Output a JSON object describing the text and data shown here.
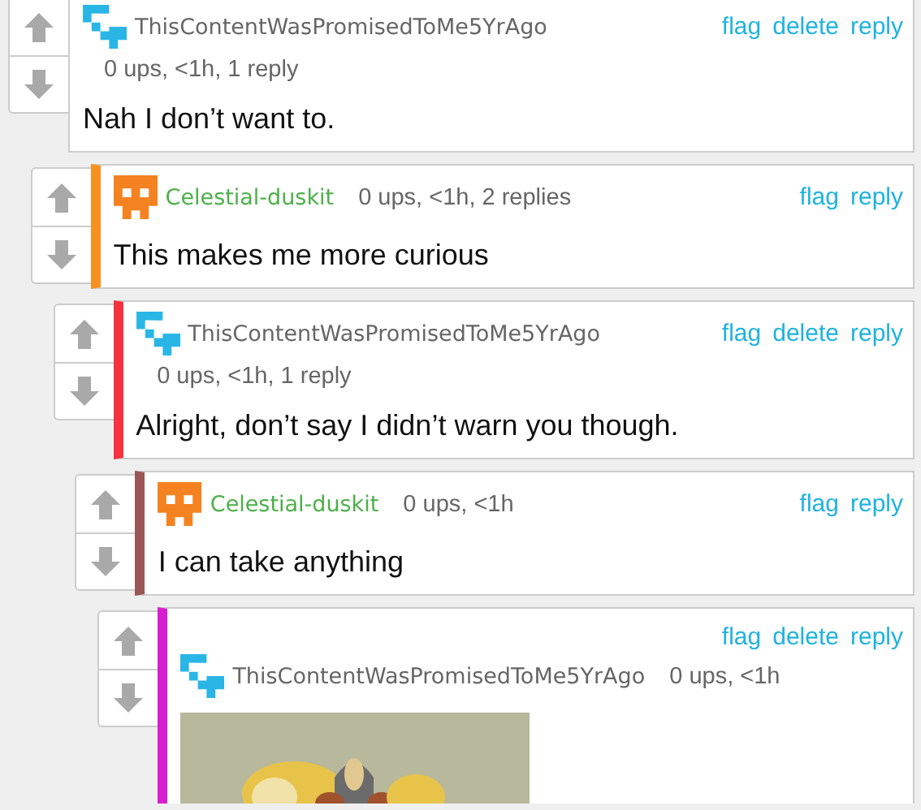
{
  "comments": [
    {
      "kind": "meta-below",
      "avatar": {
        "kind": "blocks"
      },
      "user": {
        "name": "ThisContentWasPromisedToMe5YrAgo",
        "color": "#666666"
      },
      "meta": "0 ups, <1h, 1 reply",
      "actions": [
        "flag",
        "delete",
        "reply"
      ],
      "text": "Nah I don’t want to.",
      "children": [
        {
          "kind": "meta-inline",
          "avatar": {
            "kind": "skull"
          },
          "user": {
            "name": "Celestial-duskit",
            "color": "#4db04a"
          },
          "bar": {
            "color": "#f7901e"
          },
          "meta": "0 ups, <1h, 2 replies",
          "actions": [
            "flag",
            "reply"
          ],
          "text": "This makes me more curious",
          "children": [
            {
              "kind": "meta-below",
              "avatar": {
                "kind": "blocks"
              },
              "user": {
                "name": "ThisContentWasPromisedToMe5YrAgo",
                "color": "#666666"
              },
              "bar": {
                "color": "#f5333f"
              },
              "meta": "0 ups, <1h, 1 reply",
              "actions": [
                "flag",
                "delete",
                "reply"
              ],
              "text": "Alright, don’t say I didn’t warn you though.",
              "children": [
                {
                  "kind": "meta-inline",
                  "avatar": {
                    "kind": "skull"
                  },
                  "user": {
                    "name": "Celestial-duskit",
                    "color": "#4db04a"
                  },
                  "bar": {
                    "color": "#9a5555"
                  },
                  "meta": "0 ups, <1h",
                  "actions": [
                    "flag",
                    "reply"
                  ],
                  "text": "I can take anything",
                  "children": [
                    {
                      "kind": "actions-first",
                      "avatar": {
                        "kind": "blocks"
                      },
                      "user": {
                        "name": "ThisContentWasPromisedToMe5YrAgo",
                        "color": "#666666"
                      },
                      "bar": {
                        "color": "#d81fd0"
                      },
                      "meta": "0 ups, <1h",
                      "actions": [
                        "flag",
                        "delete",
                        "reply"
                      ]
                    }
                  ]
                }
              ]
            }
          ]
        }
      ]
    }
  ]
}
